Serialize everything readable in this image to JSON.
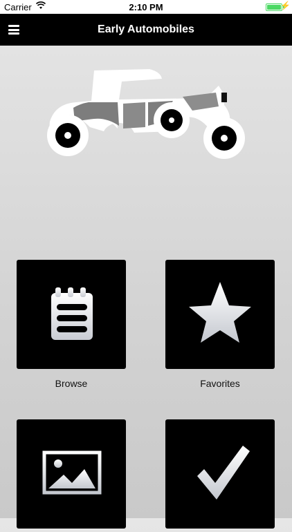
{
  "status_bar": {
    "carrier": "Carrier",
    "time": "2:10 PM"
  },
  "navbar": {
    "title": "Early Automobiles",
    "menu_icon": "hamburger-menu-icon"
  },
  "hero": {
    "icon": "vintage-car-icon"
  },
  "tiles": [
    {
      "label": "Browse",
      "icon": "notepad-list-icon"
    },
    {
      "label": "Favorites",
      "icon": "star-icon"
    },
    {
      "label": "",
      "icon": "image-gallery-icon"
    },
    {
      "label": "",
      "icon": "checkmark-icon"
    }
  ],
  "colors": {
    "navbar": "#000000",
    "tile": "#000000",
    "battery": "#4cd964"
  }
}
